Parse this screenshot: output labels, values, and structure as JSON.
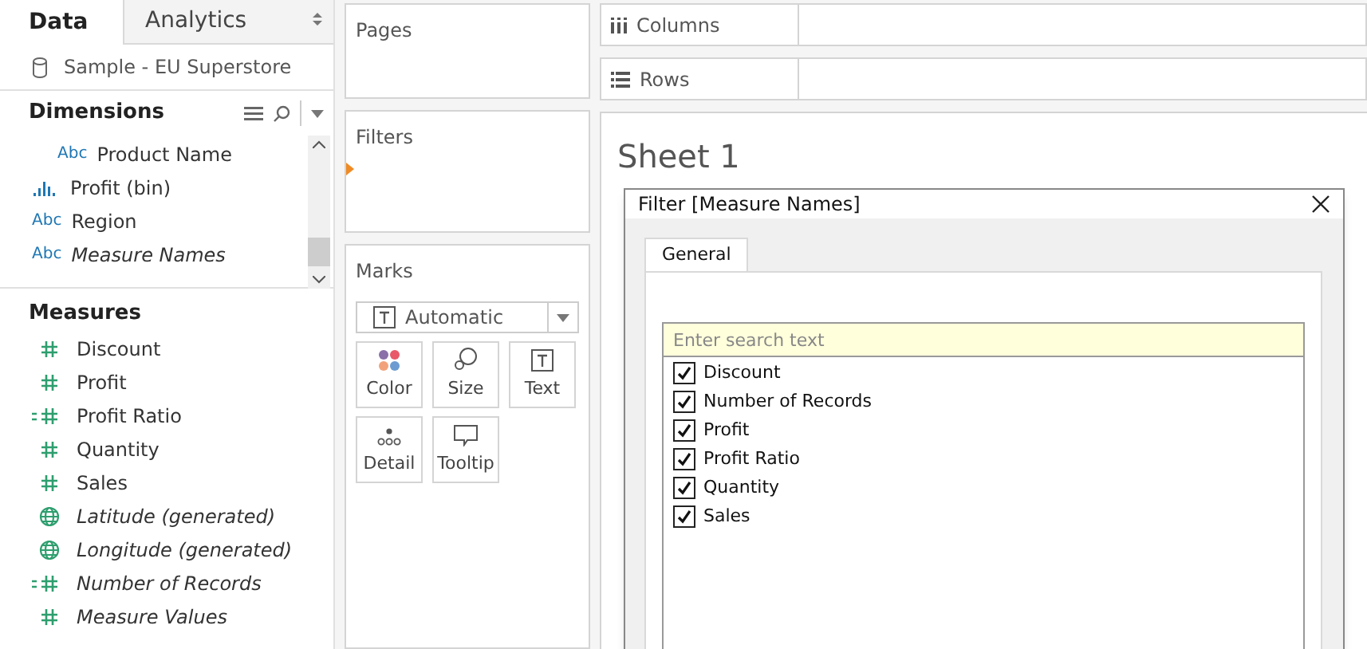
{
  "data_tabs": [
    {
      "label": "Data",
      "selected": true
    },
    {
      "label": "Analytics",
      "selected": false
    }
  ],
  "data_source": "Sample - EU Superstore",
  "dimensions": {
    "title": "Dimensions",
    "hierarchy_children": [
      {
        "label": "Product Name",
        "kind": "text",
        "type_label": "Abc",
        "generated": false
      }
    ],
    "items": [
      {
        "label": "Profit (bin)",
        "kind": "bin",
        "generated": false
      },
      {
        "label": "Region",
        "kind": "text",
        "type_label": "Abc",
        "generated": false
      },
      {
        "label": "Measure Names",
        "kind": "text",
        "type_label": "Abc",
        "generated": true
      }
    ]
  },
  "measures": {
    "title": "Measures",
    "items": [
      {
        "label": "Discount",
        "kind": "number",
        "generated": false
      },
      {
        "label": "Profit",
        "kind": "number",
        "generated": false
      },
      {
        "label": "Profit Ratio",
        "kind": "calc",
        "generated": false
      },
      {
        "label": "Quantity",
        "kind": "number",
        "generated": false
      },
      {
        "label": "Sales",
        "kind": "number",
        "generated": false
      },
      {
        "label": "Latitude (generated)",
        "kind": "geo",
        "generated": true
      },
      {
        "label": "Longitude (generated)",
        "kind": "geo",
        "generated": true
      },
      {
        "label": "Number of Records",
        "kind": "calc",
        "generated": true
      },
      {
        "label": "Measure Values",
        "kind": "number",
        "generated": true
      }
    ]
  },
  "pages": {
    "title": "Pages"
  },
  "filters": {
    "title": "Filters"
  },
  "marks": {
    "title": "Marks",
    "type": "Automatic",
    "buttons": [
      {
        "label": "Color",
        "kind": "color"
      },
      {
        "label": "Size",
        "kind": "size"
      },
      {
        "label": "Text",
        "kind": "text"
      },
      {
        "label": "Detail",
        "kind": "detail"
      },
      {
        "label": "Tooltip",
        "kind": "tooltip"
      }
    ]
  },
  "shelves": [
    {
      "label": "Columns",
      "kind": "columns"
    },
    {
      "label": "Rows",
      "kind": "rows"
    }
  ],
  "sheet_title": "Sheet 1",
  "dialog": {
    "title": "Filter [Measure Names]",
    "tabs": [
      {
        "label": "General",
        "selected": true
      }
    ],
    "search": {
      "placeholder": "Enter search text"
    },
    "items": [
      {
        "label": "Discount",
        "checked": true
      },
      {
        "label": "Number of Records",
        "checked": true
      },
      {
        "label": "Profit",
        "checked": true
      },
      {
        "label": "Profit Ratio",
        "checked": true
      },
      {
        "label": "Quantity",
        "checked": true
      },
      {
        "label": "Sales",
        "checked": true
      }
    ]
  }
}
